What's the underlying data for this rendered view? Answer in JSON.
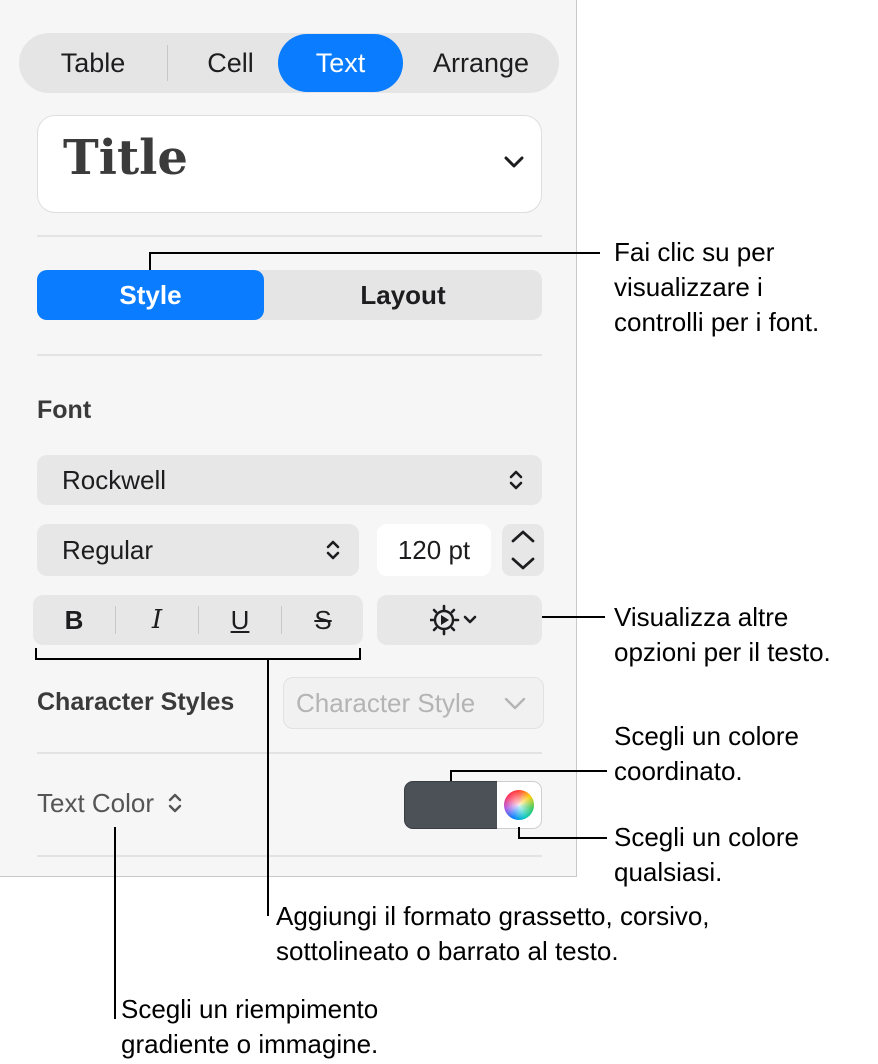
{
  "top_tabs": [
    "Table",
    "Cell",
    "Text",
    "Arrange"
  ],
  "active_tab": "Text",
  "paragraph_style": {
    "name": "Title"
  },
  "style_tabs": [
    "Style",
    "Layout"
  ],
  "active_style_tab": "Style",
  "font_section": {
    "label": "Font",
    "family": "Rockwell",
    "typeface": "Regular",
    "size": "120 pt",
    "bold": "B",
    "italic": "I",
    "underline": "U",
    "strikethrough": "S"
  },
  "character_styles": {
    "label": "Character Styles",
    "placeholder": "Character Style"
  },
  "text_color": {
    "label": "Text Color",
    "swatch": "#4c5158"
  },
  "callouts": {
    "style_tab": [
      "Fai clic su per",
      "visualizzare i",
      "controlli per i font."
    ],
    "more_options": [
      "Visualizza altre",
      "opzioni per il testo."
    ],
    "coordinated_color": [
      "Scegli un colore",
      "coordinato."
    ],
    "any_color": [
      "Scegli un colore",
      "qualsiasi."
    ],
    "formatting": [
      "Aggiungi il formato grassetto, corsivo,",
      "sottolineato o barrato al testo."
    ],
    "fill": [
      "Scegli un riempimento",
      "gradiente o immagine."
    ]
  },
  "icons": [
    "chevron-down-icon",
    "up-down-arrows-icon",
    "stepper-icon",
    "gear-icon",
    "color-wheel-icon"
  ],
  "colors": {
    "accent": "#0a7cff",
    "panel": "#f6f6f6",
    "control": "#e7e7e7"
  }
}
